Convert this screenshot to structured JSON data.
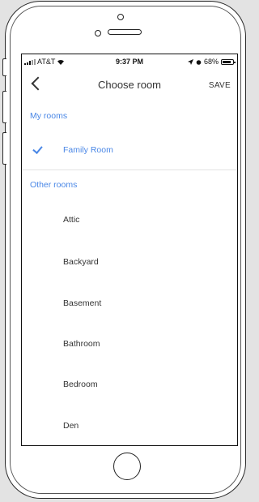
{
  "status_bar": {
    "carrier": "AT&T",
    "time": "9:37 PM",
    "battery": "68%"
  },
  "header": {
    "title": "Choose room",
    "save_label": "SAVE"
  },
  "my_rooms": {
    "heading": "My rooms",
    "items": [
      {
        "label": "Family Room",
        "selected": true
      }
    ]
  },
  "other_rooms": {
    "heading": "Other rooms",
    "items": [
      {
        "label": "Attic"
      },
      {
        "label": "Backyard"
      },
      {
        "label": "Basement"
      },
      {
        "label": "Bathroom"
      },
      {
        "label": "Bedroom"
      },
      {
        "label": "Den"
      }
    ]
  },
  "colors": {
    "accent": "#4a87e6",
    "text": "#333333"
  },
  "icons": [
    "back-chevron-icon",
    "checkmark-icon",
    "signal-icon",
    "wifi-icon",
    "location-arrow-icon",
    "alarm-icon",
    "battery-icon"
  ]
}
